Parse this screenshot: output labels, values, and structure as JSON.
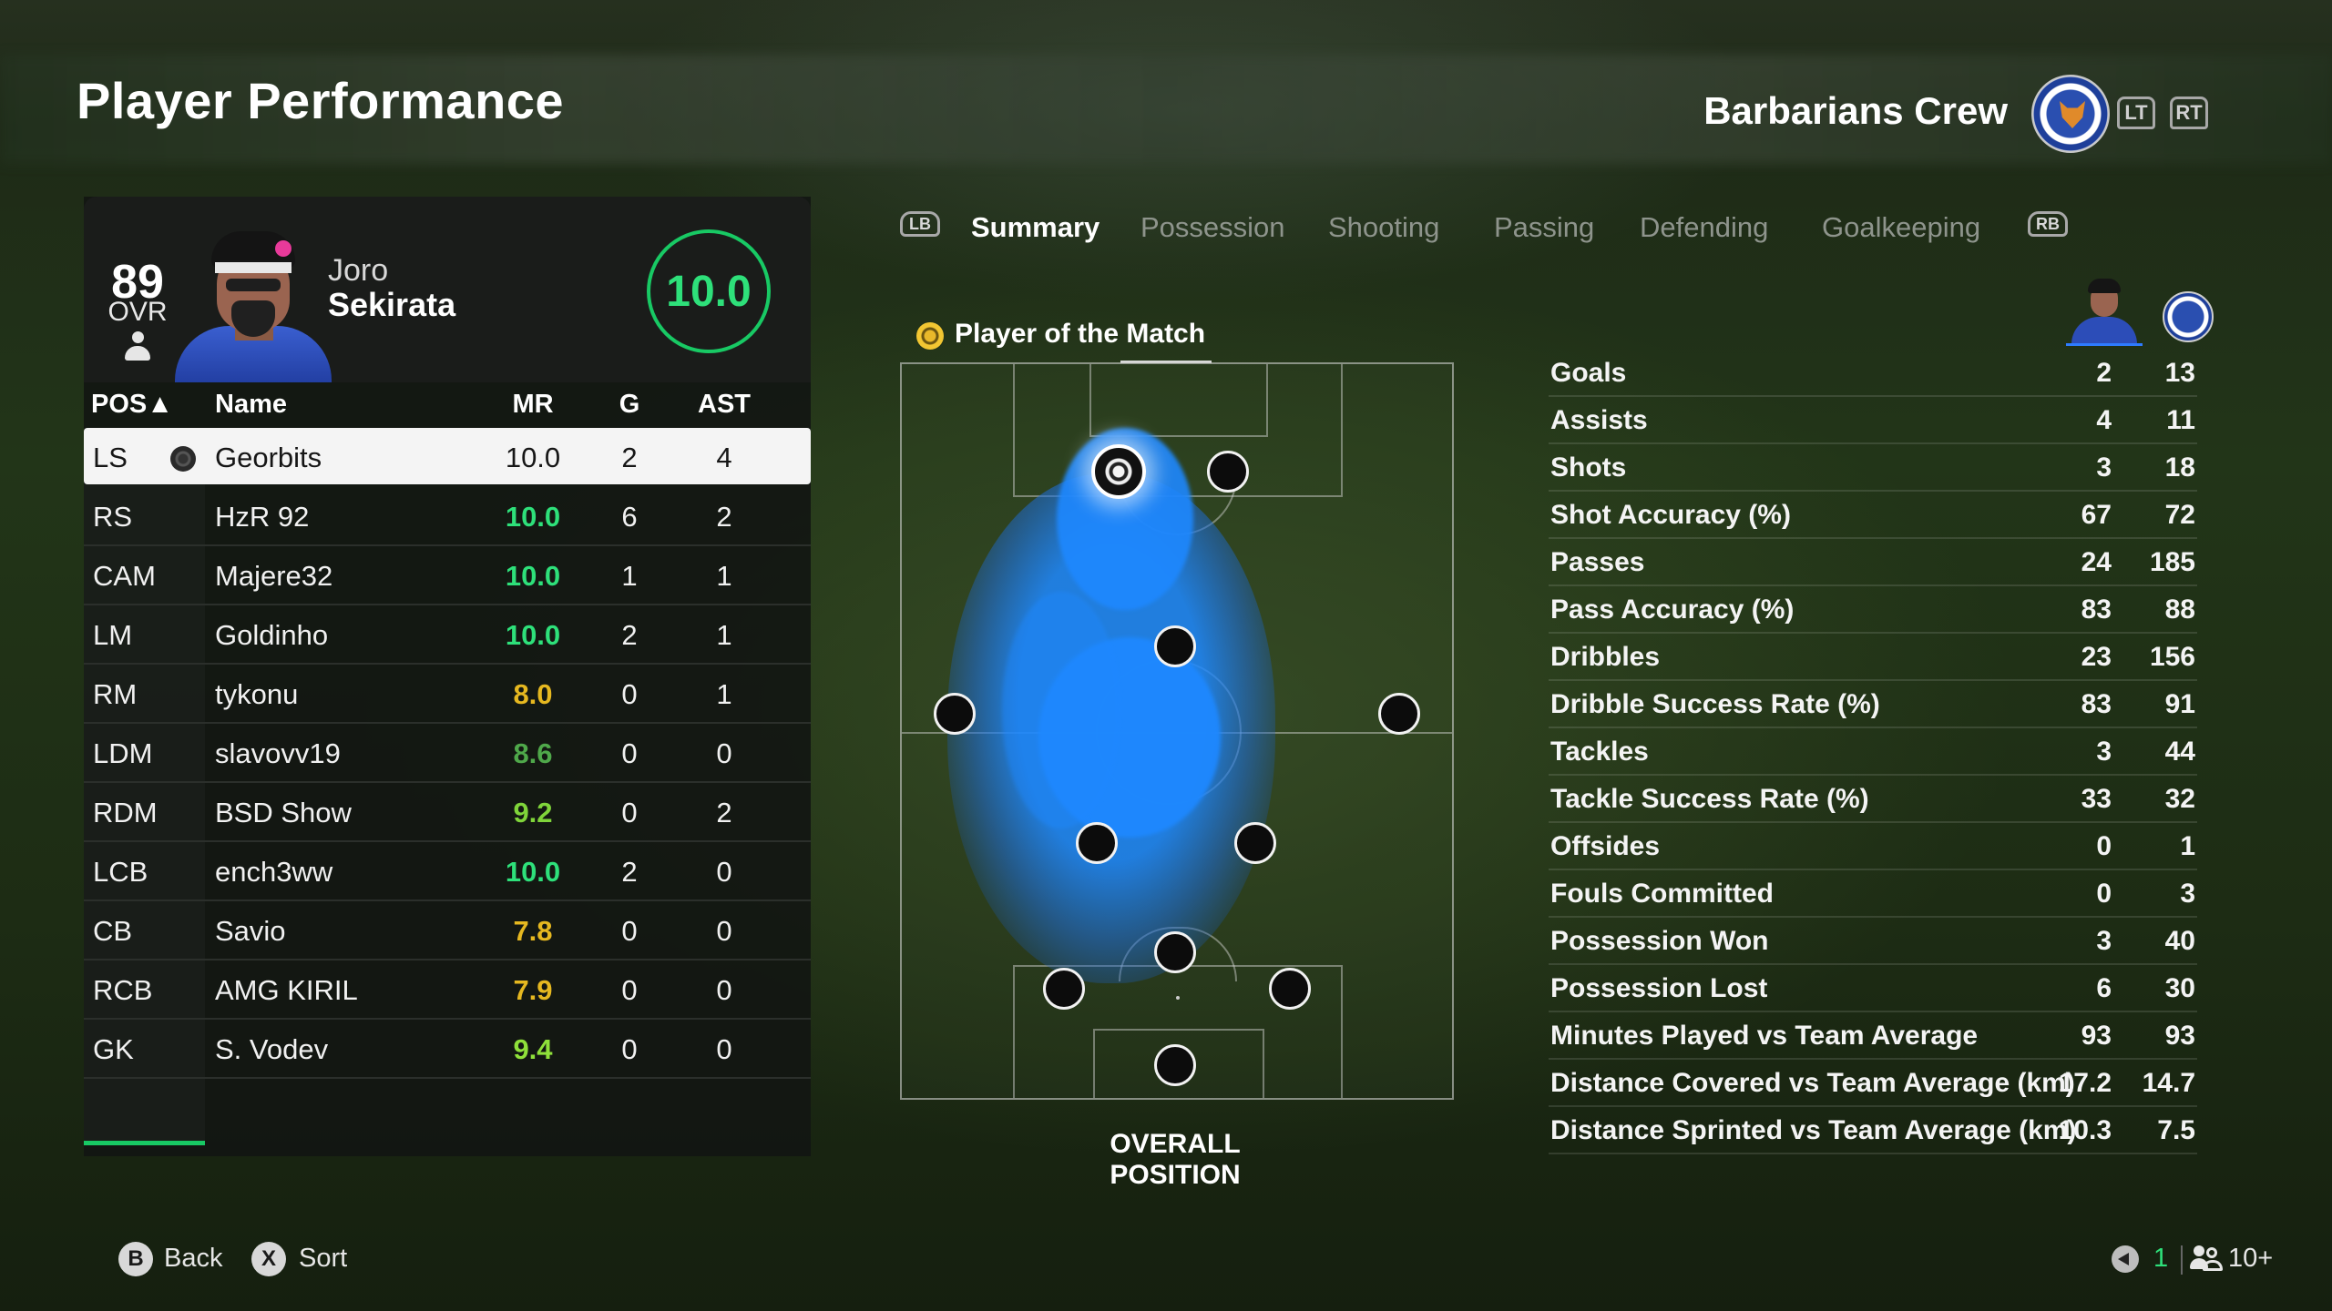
{
  "header": {
    "title": "Player Performance",
    "club_name": "Barbarians Crew",
    "lt_label": "LT",
    "rt_label": "RT"
  },
  "player_card": {
    "ovr": "89",
    "ovr_label": "OVR",
    "first_name": "Joro",
    "last_name": "Sekirata",
    "rating": "10.0"
  },
  "table": {
    "headers": {
      "pos": "POS▲",
      "name": "Name",
      "mr": "MR",
      "g": "G",
      "ast": "AST"
    },
    "rows": [
      {
        "pos": "LS",
        "name": "Georbits",
        "mr": "10.0",
        "g": "2",
        "ast": "4",
        "mr_color": "#161616"
      },
      {
        "pos": "RS",
        "name": "HzR 92",
        "mr": "10.0",
        "g": "6",
        "ast": "2",
        "mr_color": "#2ee07a"
      },
      {
        "pos": "CAM",
        "name": "Majere32",
        "mr": "10.0",
        "g": "1",
        "ast": "1",
        "mr_color": "#2ee07a"
      },
      {
        "pos": "LM",
        "name": "Goldinho",
        "mr": "10.0",
        "g": "2",
        "ast": "1",
        "mr_color": "#2ee07a"
      },
      {
        "pos": "RM",
        "name": "tykonu",
        "mr": "8.0",
        "g": "0",
        "ast": "1",
        "mr_color": "#e6b820"
      },
      {
        "pos": "LDM",
        "name": "slavovv19",
        "mr": "8.6",
        "g": "0",
        "ast": "0",
        "mr_color": "#4fa84a"
      },
      {
        "pos": "RDM",
        "name": "BSD Show",
        "mr": "9.2",
        "g": "0",
        "ast": "2",
        "mr_color": "#7fd43a"
      },
      {
        "pos": "LCB",
        "name": "ench3ww",
        "mr": "10.0",
        "g": "2",
        "ast": "0",
        "mr_color": "#2ee07a"
      },
      {
        "pos": "CB",
        "name": "Savio",
        "mr": "7.8",
        "g": "0",
        "ast": "0",
        "mr_color": "#e6b820"
      },
      {
        "pos": "RCB",
        "name": "AMG KIRIL",
        "mr": "7.9",
        "g": "0",
        "ast": "0",
        "mr_color": "#e6b820"
      },
      {
        "pos": "GK",
        "name": "S. Vodev",
        "mr": "9.4",
        "g": "0",
        "ast": "0",
        "mr_color": "#8fe03a"
      }
    ]
  },
  "tabs": {
    "lb_label": "LB",
    "rb_label": "RB",
    "items": [
      "Summary",
      "Possession",
      "Shooting",
      "Passing",
      "Defending",
      "Goalkeeping"
    ],
    "active": "Summary"
  },
  "position_view": {
    "potm_label": "Player of the Match",
    "caption": "OVERALL POSITION"
  },
  "stats": [
    {
      "label": "Goals",
      "player": "2",
      "team": "13"
    },
    {
      "label": "Assists",
      "player": "4",
      "team": "11"
    },
    {
      "label": "Shots",
      "player": "3",
      "team": "18"
    },
    {
      "label": "Shot Accuracy (%)",
      "player": "67",
      "team": "72"
    },
    {
      "label": "Passes",
      "player": "24",
      "team": "185"
    },
    {
      "label": "Pass Accuracy (%)",
      "player": "83",
      "team": "88"
    },
    {
      "label": "Dribbles",
      "player": "23",
      "team": "156"
    },
    {
      "label": "Dribble Success Rate (%)",
      "player": "83",
      "team": "91"
    },
    {
      "label": "Tackles",
      "player": "3",
      "team": "44"
    },
    {
      "label": "Tackle Success Rate (%)",
      "player": "33",
      "team": "32"
    },
    {
      "label": "Offsides",
      "player": "0",
      "team": "1"
    },
    {
      "label": "Fouls Committed",
      "player": "0",
      "team": "3"
    },
    {
      "label": "Possession Won",
      "player": "3",
      "team": "40"
    },
    {
      "label": "Possession Lost",
      "player": "6",
      "team": "30"
    },
    {
      "label": "Minutes Played vs Team Average",
      "player": "93",
      "team": "93"
    },
    {
      "label": "Distance Covered vs Team Average (km)",
      "player": "17.2",
      "team": "14.7"
    },
    {
      "label": "Distance Sprinted vs Team Average (km)",
      "player": "10.3",
      "team": "7.5"
    }
  ],
  "footer": {
    "back_key": "B",
    "back_label": "Back",
    "sort_key": "X",
    "sort_label": "Sort",
    "voice_count": "1",
    "party_count": "10+"
  },
  "colors": {
    "accent_green": "#18c964",
    "heatmap_blue": "#1e88ff"
  }
}
